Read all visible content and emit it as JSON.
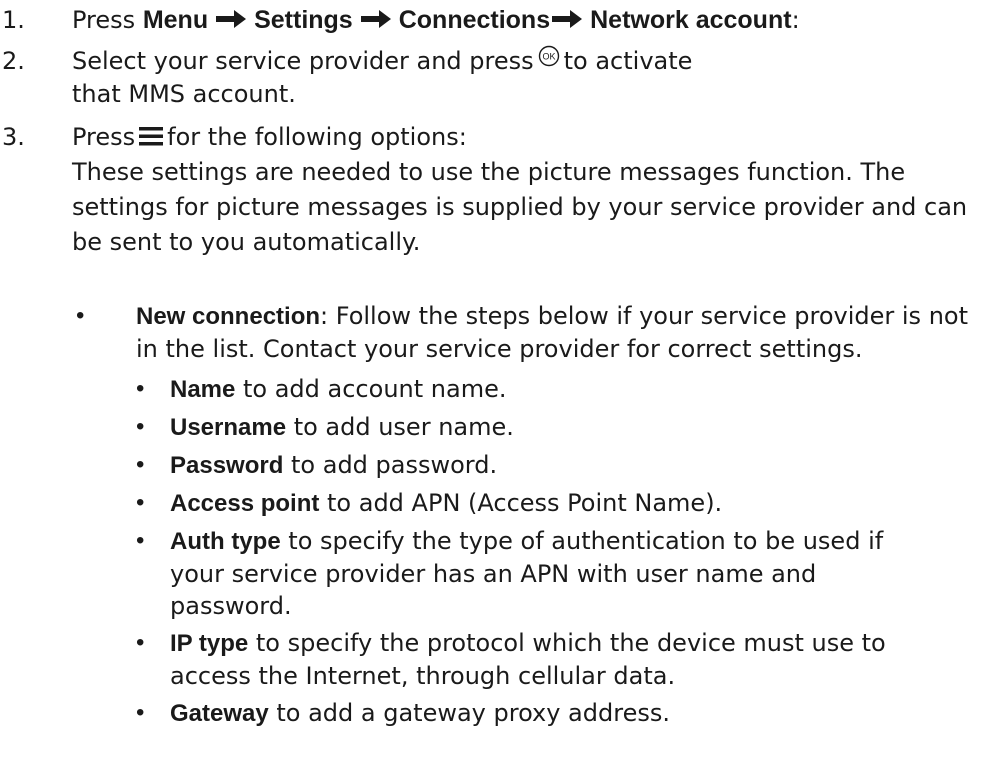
{
  "steps": [
    {
      "number": "1.",
      "press": "Press",
      "path": [
        "Menu",
        "Settings",
        "Connections",
        "Network account"
      ],
      "colon": ":"
    },
    {
      "number": "2.",
      "text_before": "Select your service provider and press",
      "text_after": "to activate that MMS account.",
      "icon": "ok-button-icon"
    },
    {
      "number": "3.",
      "text_before": "Press",
      "text_after": "for the following options:",
      "icon": "menu-icon",
      "paragraph": "These settings are needed to use the picture messages function. The settings for picture messages is supplied by your service provider and can be sent to you automatically."
    }
  ],
  "bullets": [
    {
      "term": "New connection",
      "text": ": Follow the steps below if your service provider is not in the list. Contact your service provider for correct settings."
    }
  ],
  "sub_bullets": [
    {
      "term": "Name",
      "text": " to add account name."
    },
    {
      "term": "Username",
      "text": " to add user name."
    },
    {
      "term": "Password",
      "text": " to add password."
    },
    {
      "term": "Access point",
      "text": " to add APN (Access Point Name)."
    },
    {
      "term": "Auth type",
      "text": " to specify the type of authentication to be used if your service provider has an APN with user name and password."
    },
    {
      "term": "IP type",
      "text": " to specify the protocol which the device must use to access the Internet, through cellular data."
    },
    {
      "term": "Gateway",
      "text": " to add a gateway proxy address."
    }
  ],
  "bullet_char": "•",
  "colors": {
    "text": "#1a1a1a",
    "background": "#ffffff"
  }
}
